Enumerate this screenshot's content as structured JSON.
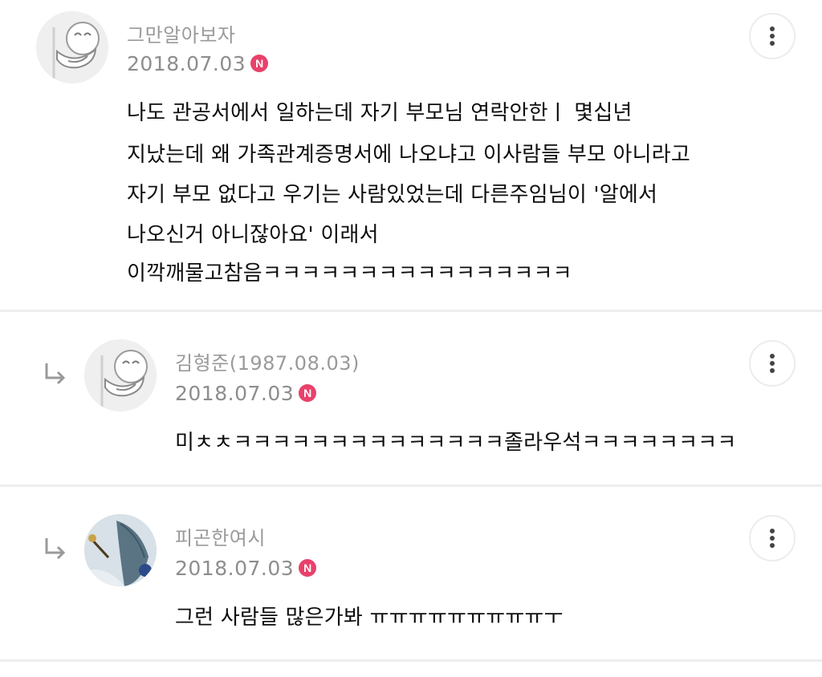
{
  "comments": [
    {
      "author": "그만알아보자",
      "date": "2018.07.03",
      "badge": "N",
      "lines": [
        "나도 관공서에서 일하는데 자기 부모님 연락안한ㅣ 몇십년",
        "지났는데 왜 가족관계증명서에 나오냐고 이사람들 부모 아니라고",
        "자기 부모 없다고 우기는 사람있었는데 다른주임님이 '알에서",
        "나오신거 아니잖아요' 이래서",
        "이깍깨물고참음ㅋㅋㅋㅋㅋㅋㅋㅋㅋㅋㅋㅋㅋㅋㅋㅋ"
      ]
    },
    {
      "author": "김형준(1987.08.03)",
      "date": "2018.07.03",
      "badge": "N",
      "lines": [
        "미ㅊㅊㅋㅋㅋㅋㅋㅋㅋㅋㅋㅋㅋㅋㅋㅋ졸라우석ㅋㅋㅋㅋㅋㅋㅋㅋ"
      ]
    },
    {
      "author": "피곤한여시",
      "date": "2018.07.03",
      "badge": "N",
      "lines": [
        "그런 사람들 많은가봐 ㅠㅠㅠㅠㅠㅠㅠㅠㅠㅜ"
      ]
    }
  ],
  "icons": {
    "more": "more-vertical-icon",
    "reply": "reply-arrow-icon"
  },
  "colors": {
    "badge": "#e8416a",
    "meta_text": "#8d8d8d",
    "divider": "#eeeeee"
  }
}
